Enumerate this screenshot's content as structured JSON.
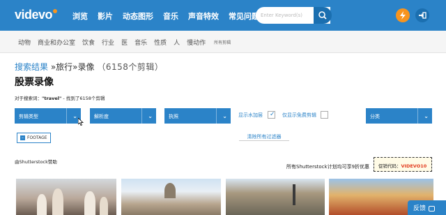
{
  "header": {
    "logo": "videvo",
    "nav": [
      "浏览",
      "影片",
      "动态图形",
      "音乐",
      "声音特效",
      "常见问题解答"
    ],
    "search_placeholder": "Enter Keyword(s)"
  },
  "subnav": {
    "items": [
      "动物",
      "商业和办公室",
      "饮食",
      "行业",
      "医",
      "音乐",
      "性质",
      "人",
      "慢动作"
    ],
    "all_label": "所有剪辑"
  },
  "breadcrumb": {
    "root": "搜索结果",
    "path": " »旅行»录像",
    "count": "（6158个剪辑）"
  },
  "page_title": "股票录像",
  "result_line": {
    "prefix": "对于搜索词：",
    "term": "\"travel\"",
    "suffix": " - 找到了6158个剪辑"
  },
  "filters": {
    "clip_type": "剪辑类型",
    "resolution": "解析度",
    "license": "执照",
    "show_watermark": "显示水加层",
    "free_only": "仅显示免费剪辑",
    "category": "分类"
  },
  "active_tag": "FOOTAGE",
  "clear_filters": "清除所有过滤器",
  "sponsored_by": "由Shutterstock赞助",
  "discount_text": "所有Shutterstock计划均可享9折优惠",
  "promo": {
    "label": "促销代码：",
    "code": "VIDEVO10"
  },
  "feedback": "反馈",
  "colors": {
    "primary": "#2b83c8",
    "accent_orange": "#f7941e",
    "promo_code": "#e23b1e"
  }
}
